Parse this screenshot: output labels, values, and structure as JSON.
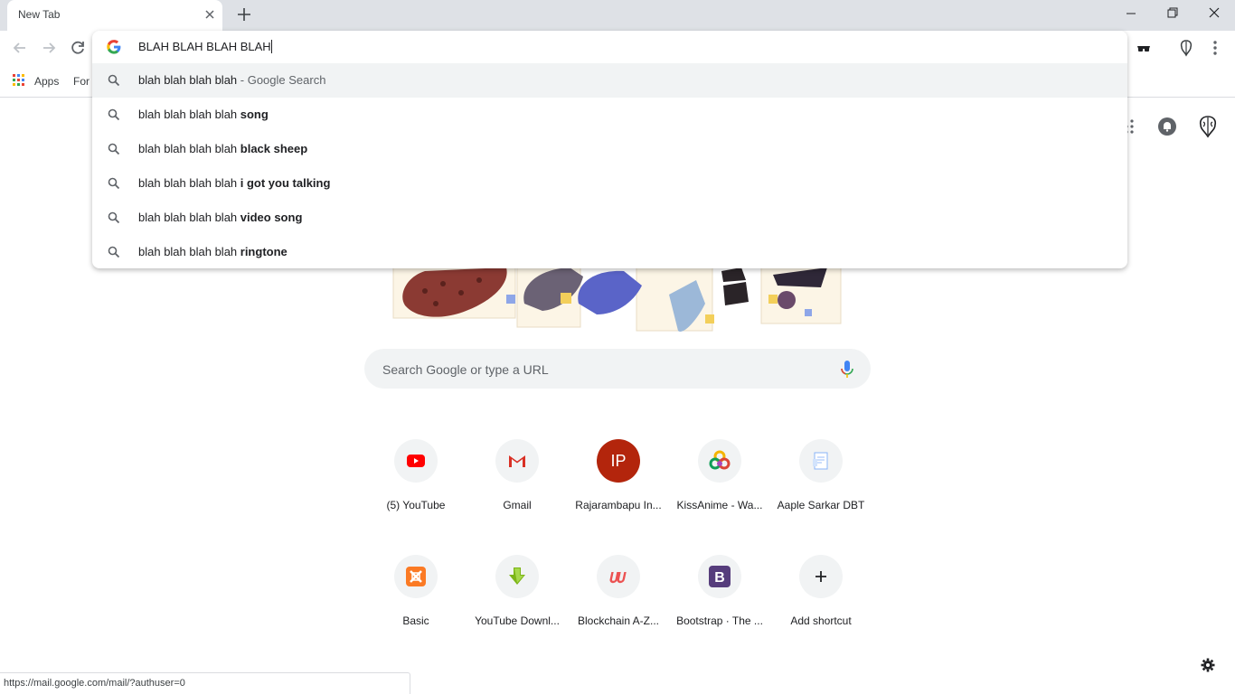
{
  "tab": {
    "title": "New Tab",
    "close_icon": "close-icon",
    "new_tab_icon": "plus-icon"
  },
  "window": {
    "minimize_icon": "minimize-icon",
    "maximize_icon": "restore-icon",
    "close_icon": "close-icon"
  },
  "toolbar": {
    "back_icon": "arrow-left-icon",
    "forward_icon": "arrow-right-icon",
    "reload_icon": "reload-icon",
    "extensions": [
      "spy-icon",
      "brain-icon"
    ],
    "menu_icon": "kebab-menu-icon"
  },
  "bookmarks": {
    "apps_label": "Apps",
    "partial_item": "For"
  },
  "omnibox": {
    "input_value": "BLAH BLAH BLAH BLAH",
    "suggestions": [
      {
        "prefix": "blah blah blah blah",
        "suffix": "",
        "description": " - Google Search"
      },
      {
        "prefix": "blah blah blah blah ",
        "suffix": "song",
        "description": ""
      },
      {
        "prefix": "blah blah blah blah ",
        "suffix": "black sheep",
        "description": ""
      },
      {
        "prefix": "blah blah blah blah ",
        "suffix": "i got you talking",
        "description": ""
      },
      {
        "prefix": "blah blah blah blah ",
        "suffix": "video song",
        "description": ""
      },
      {
        "prefix": "blah blah blah blah ",
        "suffix": "ringtone",
        "description": ""
      }
    ]
  },
  "ntp": {
    "search_placeholder": "Search Google or type a URL",
    "shortcuts_row1": [
      {
        "label": "(5) YouTube",
        "icon": "youtube-icon"
      },
      {
        "label": "Gmail",
        "icon": "gmail-icon"
      },
      {
        "label": "Rajarambapu In...",
        "icon": "ip-badge",
        "badge_text": "IP"
      },
      {
        "label": "KissAnime - Wa...",
        "icon": "kissanime-icon"
      },
      {
        "label": "Aaple Sarkar DBT",
        "icon": "document-icon"
      }
    ],
    "shortcuts_row2": [
      {
        "label": "Basic",
        "icon": "xampp-icon"
      },
      {
        "label": "YouTube Downl...",
        "icon": "download-arrow-icon"
      },
      {
        "label": "Blockchain A-Z...",
        "icon": "udemy-icon"
      },
      {
        "label": "Bootstrap · The ...",
        "icon": "bootstrap-icon"
      },
      {
        "label": "Add shortcut",
        "icon": "plus-icon"
      }
    ]
  },
  "status_url": "https://mail.google.com/mail/?authuser=0",
  "colors": {
    "titlebar": "#dee1e6",
    "ip_badge": "#b3250c",
    "youtube": "#ff0000",
    "bootstrap": "#563d7c"
  }
}
